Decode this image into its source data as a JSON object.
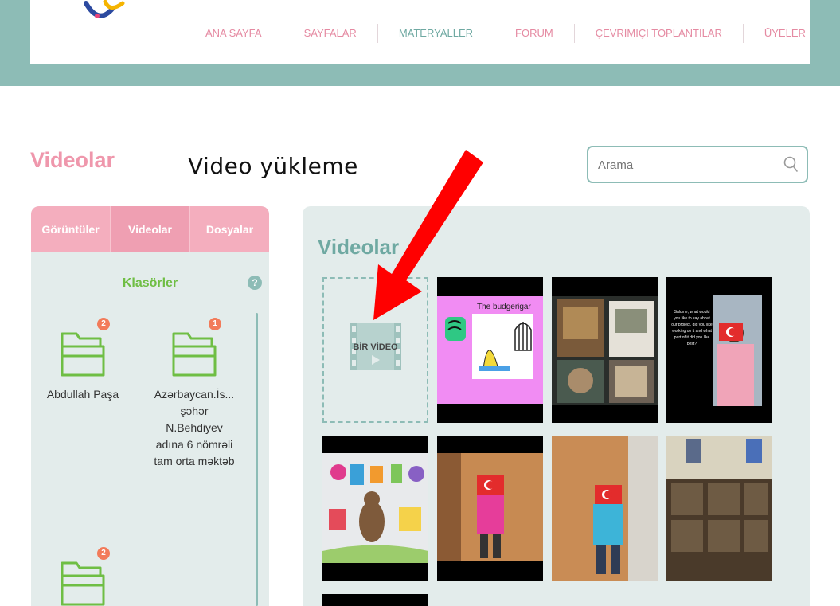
{
  "nav": {
    "items": [
      "ANA SAYFA",
      "SAYFALAR",
      "MATERYALLER",
      "FORUM",
      "ÇEVRIMIÇI TOPLANTILAR",
      "ÜYELER"
    ],
    "active": "MATERYALLER"
  },
  "page": {
    "title": "Videolar",
    "annotation": "Video yükleme"
  },
  "search": {
    "placeholder": "Arama"
  },
  "sidebar": {
    "tabs": [
      "Görüntüler",
      "Videolar",
      "Dosyalar"
    ],
    "active_tab": "Videolar",
    "folders_heading": "Klasörler",
    "folders": [
      {
        "badge": "2",
        "name": "Abdullah Paşa"
      },
      {
        "badge": "1",
        "name": "Azərbaycan.İs... şəhər N.Behdiyev adına 6 nömrəli tam orta məktəb"
      },
      {
        "badge": "2",
        "name": ""
      }
    ]
  },
  "gallery": {
    "title": "Videolar",
    "upload_label": "BİR VİDEO",
    "thumbnails": [
      {
        "caption": "The budgerigar"
      },
      {
        "caption": ""
      },
      {
        "caption": "Salome, what would you like to say about our project, did you like working on it and what part of it did you like best?"
      },
      {
        "caption": ""
      },
      {
        "caption": ""
      },
      {
        "caption": ""
      },
      {
        "caption": ""
      }
    ]
  },
  "colors": {
    "brand_teal": "#8dbcb6",
    "brand_pink": "#ef97ac",
    "folder_green": "#6fbe44",
    "arrow_red": "#ff0000"
  }
}
